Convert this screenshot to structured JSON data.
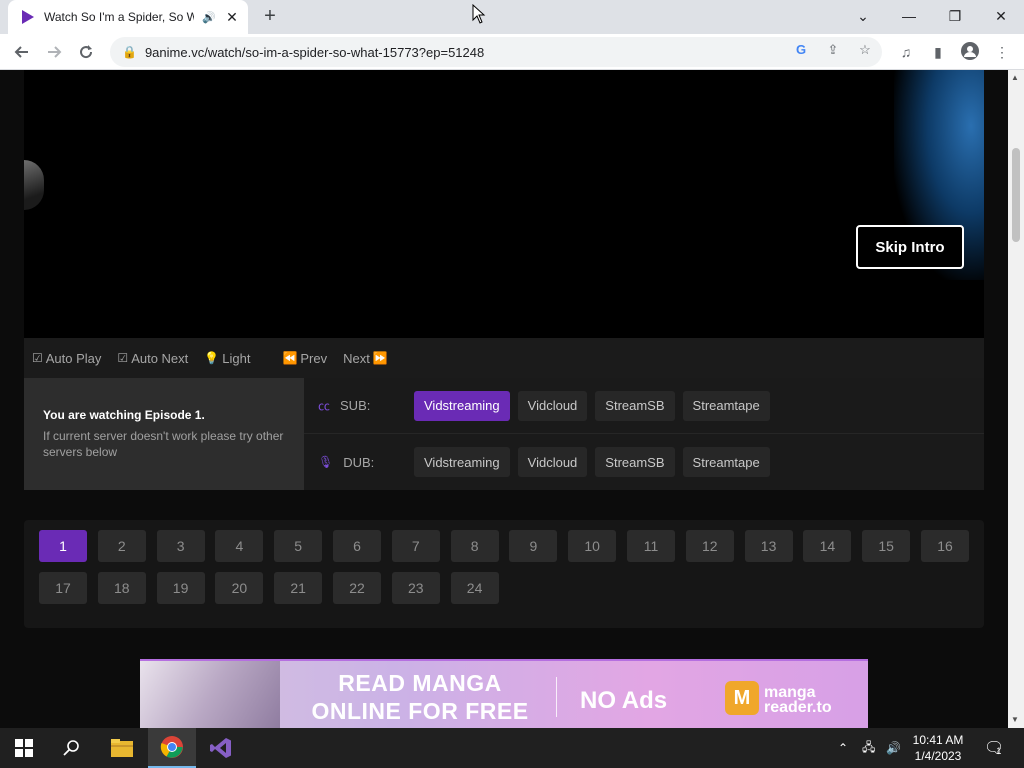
{
  "browser": {
    "tab_title": "Watch So I'm a Spider, So W",
    "url": "9anime.vc/watch/so-im-a-spider-so-what-15773?ep=51248",
    "new_tab": "+",
    "close_tab": "✕",
    "win_min": "—",
    "win_max": "❐",
    "win_close": "✕",
    "tab_list": "⌄"
  },
  "player": {
    "skip_label": "Skip Intro"
  },
  "controls": {
    "auto_play": "Auto Play",
    "auto_next": "Auto Next",
    "light": "Light",
    "prev": "Prev",
    "next": "Next"
  },
  "servers": {
    "watching_title": "You are watching Episode 1.",
    "watching_hint": "If current server doesn't work please try other servers below",
    "sub_label": "SUB:",
    "dub_label": "DUB:",
    "sub": [
      "Vidstreaming",
      "Vidcloud",
      "StreamSB",
      "Streamtape"
    ],
    "dub": [
      "Vidstreaming",
      "Vidcloud",
      "StreamSB",
      "Streamtape"
    ],
    "active_sub": "Vidstreaming"
  },
  "episodes": {
    "list": [
      "1",
      "2",
      "3",
      "4",
      "5",
      "6",
      "7",
      "8",
      "9",
      "10",
      "11",
      "12",
      "13",
      "14",
      "15",
      "16",
      "17",
      "18",
      "19",
      "20",
      "21",
      "22",
      "23",
      "24"
    ],
    "active": "1"
  },
  "banner": {
    "read_line1": "READ MANGA",
    "read_line2": "ONLINE FOR FREE",
    "no_ads": "NO Ads",
    "logo_letter": "M",
    "brand_line1": "manga",
    "brand_line2": "reader.to"
  },
  "taskbar": {
    "time": "10:41 AM",
    "date": "1/4/2023",
    "notifications": "1"
  },
  "colors": {
    "accent": "#6a2bb5",
    "page_bg": "#0c0c0c"
  }
}
